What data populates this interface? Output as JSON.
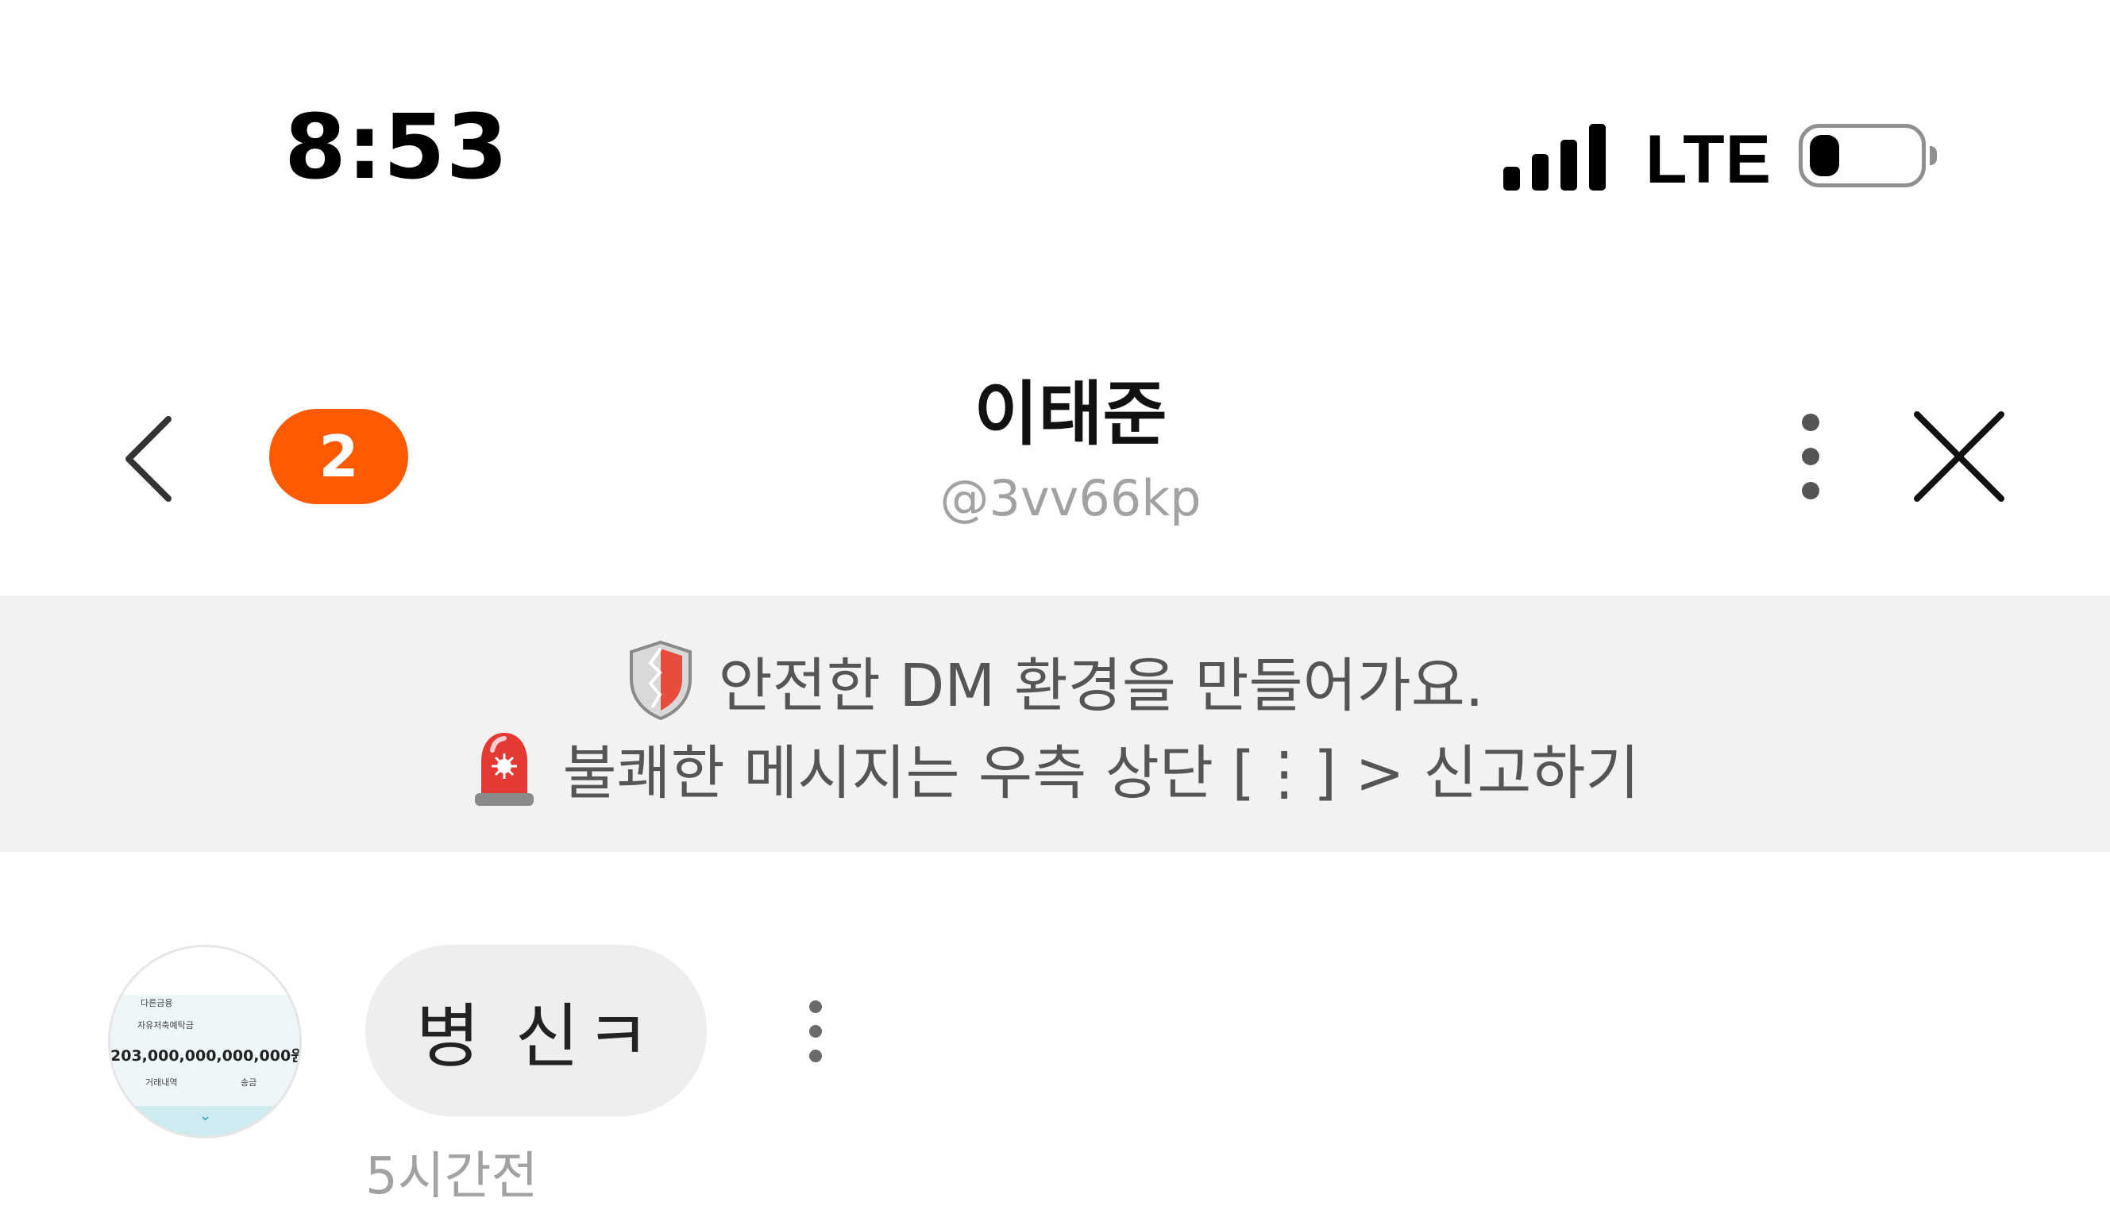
{
  "status_bar": {
    "time": "8:53",
    "network": "LTE",
    "battery_level_fraction": 0.2,
    "signal_bars": 4
  },
  "header": {
    "back_icon": "chevron-left-icon",
    "unread_count": "2",
    "peer_name": "이태준",
    "peer_handle": "@3vv66kp",
    "more_icon": "vertical-ellipsis-icon",
    "close_icon": "close-icon",
    "badge_color": "#ff5a00"
  },
  "notice": {
    "line1_icon": "shield-icon",
    "line1_text": "안전한 DM 환경을 만들어가요.",
    "line2_icon": "siren-icon",
    "line2_text": "불쾌한 메시지는 우측 상단 [⋮] > 신고하기"
  },
  "message": {
    "avatar": {
      "amount_text": "203,000,000,000,000원",
      "small_labels": [
        "다른금융",
        "자유저축예탁금",
        "거래내역",
        "송금"
      ]
    },
    "bubble_text": "병 신ㅋ",
    "options_icon": "vertical-ellipsis-icon",
    "timestamp": "5시간전"
  }
}
